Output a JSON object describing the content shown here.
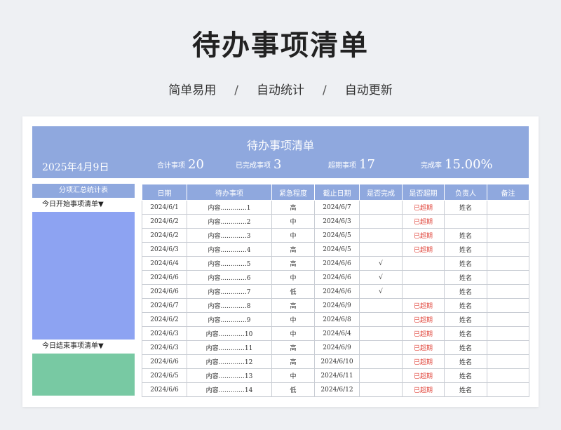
{
  "header": {
    "title": "待办事项清单",
    "subtitle": [
      "简单易用",
      "自动统计",
      "自动更新"
    ],
    "separator": "/"
  },
  "banner": {
    "title": "待办事项清单",
    "date": "2025年4月9日",
    "stats": [
      {
        "label": "合计事项",
        "value": "20"
      },
      {
        "label": "已完成事项",
        "value": "3"
      },
      {
        "label": "超期事项",
        "value": "17"
      },
      {
        "label": "完成率",
        "value": "15.00%"
      }
    ],
    "color": "#8fa8de"
  },
  "sidebar": {
    "header": "分项汇总统计表",
    "today_start": "今日开始事项清单▼",
    "today_end": "今日结束事项清单▼",
    "colors": {
      "start_block": "#8da3f2",
      "end_block": "#78c9a3"
    }
  },
  "table": {
    "columns": [
      "日期",
      "待办事项",
      "紧急程度",
      "截止日期",
      "是否完成",
      "是否超期",
      "负责人",
      "备注"
    ],
    "rows": [
      {
        "date": "2024/6/1",
        "item": "内容.............1",
        "urgency": "高",
        "deadline": "2024/6/7",
        "done": "",
        "overdue": "已超期",
        "owner": "姓名",
        "note": ""
      },
      {
        "date": "2024/6/2",
        "item": "内容.............2",
        "urgency": "中",
        "deadline": "2024/6/3",
        "done": "",
        "overdue": "已超期",
        "owner": "",
        "note": ""
      },
      {
        "date": "2024/6/2",
        "item": "内容.............3",
        "urgency": "中",
        "deadline": "2024/6/5",
        "done": "",
        "overdue": "已超期",
        "owner": "姓名",
        "note": ""
      },
      {
        "date": "2024/6/3",
        "item": "内容.............4",
        "urgency": "高",
        "deadline": "2024/6/5",
        "done": "",
        "overdue": "已超期",
        "owner": "姓名",
        "note": ""
      },
      {
        "date": "2024/6/4",
        "item": "内容.............5",
        "urgency": "高",
        "deadline": "2024/6/6",
        "done": "√",
        "overdue": "",
        "owner": "姓名",
        "note": ""
      },
      {
        "date": "2024/6/6",
        "item": "内容.............6",
        "urgency": "中",
        "deadline": "2024/6/6",
        "done": "√",
        "overdue": "",
        "owner": "姓名",
        "note": ""
      },
      {
        "date": "2024/6/6",
        "item": "内容.............7",
        "urgency": "低",
        "deadline": "2024/6/6",
        "done": "√",
        "overdue": "",
        "owner": "姓名",
        "note": ""
      },
      {
        "date": "2024/6/7",
        "item": "内容.............8",
        "urgency": "高",
        "deadline": "2024/6/9",
        "done": "",
        "overdue": "已超期",
        "owner": "姓名",
        "note": ""
      },
      {
        "date": "2024/6/2",
        "item": "内容.............9",
        "urgency": "中",
        "deadline": "2024/6/8",
        "done": "",
        "overdue": "已超期",
        "owner": "姓名",
        "note": ""
      },
      {
        "date": "2024/6/3",
        "item": "内容.............10",
        "urgency": "中",
        "deadline": "2024/6/4",
        "done": "",
        "overdue": "已超期",
        "owner": "姓名",
        "note": ""
      },
      {
        "date": "2024/6/3",
        "item": "内容.............11",
        "urgency": "高",
        "deadline": "2024/6/9",
        "done": "",
        "overdue": "已超期",
        "owner": "姓名",
        "note": ""
      },
      {
        "date": "2024/6/6",
        "item": "内容.............12",
        "urgency": "高",
        "deadline": "2024/6/10",
        "done": "",
        "overdue": "已超期",
        "owner": "姓名",
        "note": ""
      },
      {
        "date": "2024/6/5",
        "item": "内容.............13",
        "urgency": "中",
        "deadline": "2024/6/11",
        "done": "",
        "overdue": "已超期",
        "owner": "姓名",
        "note": ""
      },
      {
        "date": "2024/6/6",
        "item": "内容.............14",
        "urgency": "低",
        "deadline": "2024/6/12",
        "done": "",
        "overdue": "已超期",
        "owner": "姓名",
        "note": ""
      }
    ],
    "overdue_color": "#e0463c"
  }
}
